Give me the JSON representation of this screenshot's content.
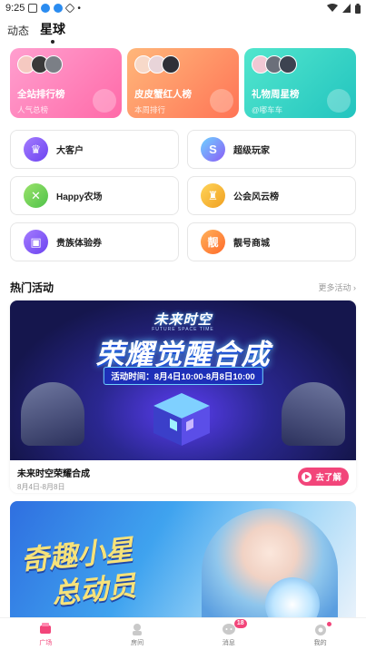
{
  "status_bar": {
    "time": "9:25"
  },
  "top_tabs": [
    {
      "label": "动态",
      "active": false
    },
    {
      "label": "星球",
      "active": true
    }
  ],
  "rank_cards": [
    {
      "title": "全站排行榜",
      "subtitle": "人气总榜",
      "icon": "trophy-icon",
      "gradient": [
        "#ff8fc8",
        "#ff6fae"
      ]
    },
    {
      "title": "皮皮蟹红人榜",
      "subtitle": "本周排行",
      "icon": "star-icon",
      "gradient": [
        "#ffb36b",
        "#ff7a55"
      ]
    },
    {
      "title": "礼物周星榜",
      "subtitle": "@嘟车车",
      "icon": "star-icon",
      "gradient": [
        "#4ee3c9",
        "#27c9c0"
      ]
    }
  ],
  "features": [
    {
      "label": "大客户",
      "icon": "crown-icon",
      "glyph": "♛",
      "color": "#8a5cf6"
    },
    {
      "label": "超级玩家",
      "icon": "gamepad-icon",
      "glyph": "S",
      "color": "#7b6cf6"
    },
    {
      "label": "Happy农场",
      "icon": "farm-icon",
      "glyph": "✕",
      "color": "#7bd55a"
    },
    {
      "label": "公会风云榜",
      "icon": "trophy-icon",
      "glyph": "♜",
      "color": "#f2b635"
    },
    {
      "label": "贵族体验券",
      "icon": "ticket-icon",
      "glyph": "▣",
      "color": "#8b5cf6"
    },
    {
      "label": "靓号商城",
      "icon": "shop-icon",
      "glyph": "靓",
      "color": "#ff8a3d"
    }
  ],
  "section": {
    "title": "热门活动",
    "more": "更多活动"
  },
  "activity": {
    "banner_brand": "未来时空",
    "banner_brand_sub": "FUTURE SPACE TIME",
    "banner_headline": "荣耀觉醒合成",
    "banner_time": "活动时间：8月4日10:00-8月8日10:00",
    "name": "未来时空荣耀合成",
    "date": "8月4日-8月8日",
    "button": "去了解"
  },
  "banner2": {
    "text_line1": "奇趣小星",
    "text_line2": "总动员"
  },
  "bottom_nav": [
    {
      "label": "广场",
      "icon": "plaza-icon",
      "active": true
    },
    {
      "label": "房间",
      "icon": "room-icon",
      "active": false
    },
    {
      "label": "消息",
      "icon": "message-icon",
      "active": false,
      "badge": "18"
    },
    {
      "label": "我的",
      "icon": "profile-icon",
      "active": false,
      "dot": true
    }
  ],
  "colors": {
    "accent": "#f2457a",
    "text": "#222222",
    "muted": "#999999"
  }
}
